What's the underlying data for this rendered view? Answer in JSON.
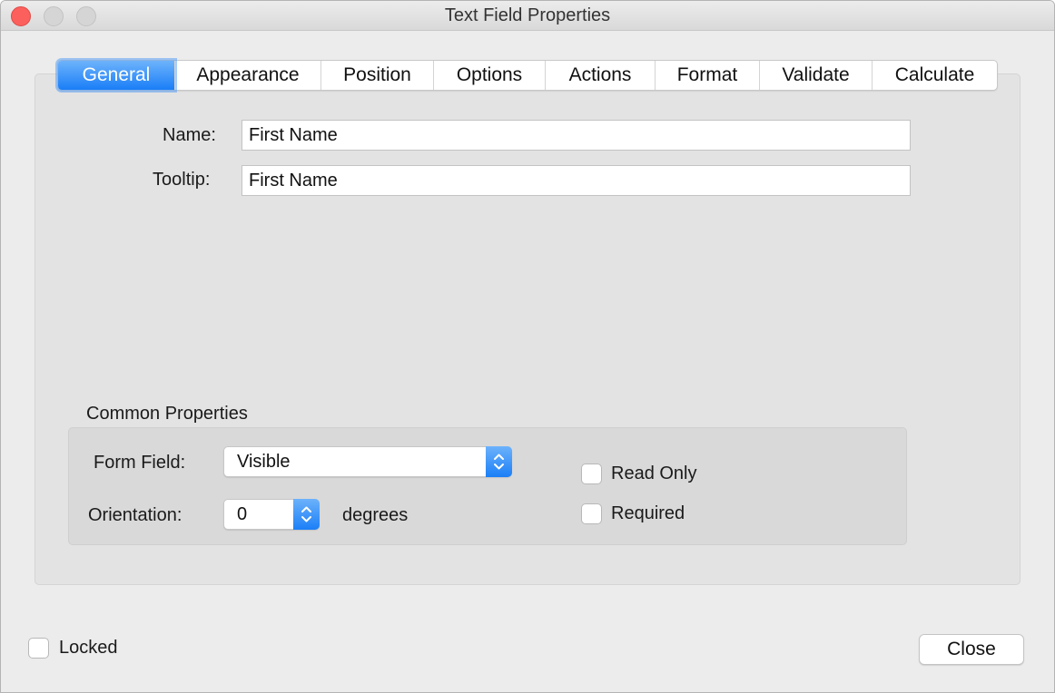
{
  "window": {
    "title": "Text Field Properties"
  },
  "tabs": [
    {
      "label": "General",
      "active": true
    },
    {
      "label": "Appearance"
    },
    {
      "label": "Position"
    },
    {
      "label": "Options"
    },
    {
      "label": "Actions"
    },
    {
      "label": "Format"
    },
    {
      "label": "Validate"
    },
    {
      "label": "Calculate"
    }
  ],
  "general": {
    "name_label": "Name:",
    "name_value": "First Name",
    "tooltip_label": "Tooltip:",
    "tooltip_value": "First Name"
  },
  "common": {
    "heading": "Common Properties",
    "form_field_label": "Form Field:",
    "form_field_value": "Visible",
    "orientation_label": "Orientation:",
    "orientation_value": "0",
    "orientation_unit": "degrees",
    "read_only_label": "Read Only",
    "read_only_checked": false,
    "required_label": "Required",
    "required_checked": false
  },
  "footer": {
    "locked_label": "Locked",
    "locked_checked": false,
    "close_label": "Close"
  },
  "colors": {
    "accent": "#1a7ef7",
    "close_traffic": "#fc605c"
  }
}
